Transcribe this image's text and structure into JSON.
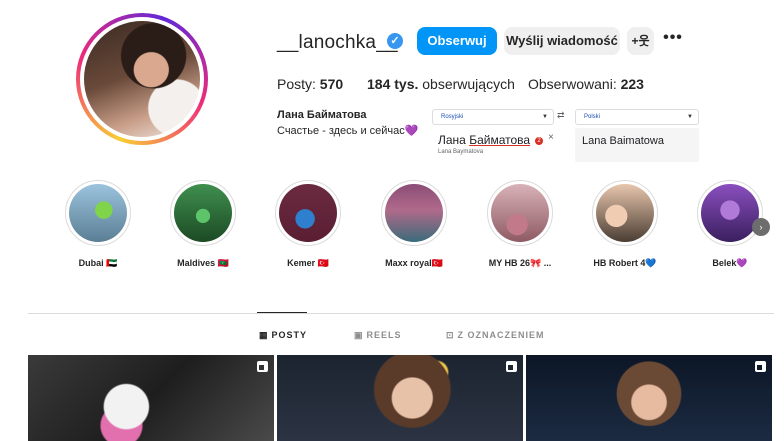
{
  "profile": {
    "username": "__lanochka__",
    "verified_icon": "verified-badge-icon",
    "follow_label": "Obserwuj",
    "message_label": "Wyślij wiadomość",
    "add_user_label": "+웃",
    "more_label": "•••",
    "posts_label": "Posty:",
    "posts_count": "570",
    "followers_count": "184 tys.",
    "followers_label": "obserwujących",
    "following_label": "Obserwowani:",
    "following_count": "223",
    "full_name": "Лана Байматова",
    "bio": "Счастье - здесь и сейчас💜"
  },
  "translator": {
    "source_lang": "Rosyjski",
    "target_lang": "Polski",
    "swap_icon": "⇄",
    "source_text_part1": "Лана ",
    "source_text_part2": "Байматова",
    "source_transliteration": "Lana Baymatova",
    "badge": "2",
    "close_label": "×",
    "output_text": "Lana Baimatowa"
  },
  "highlights": [
    {
      "label": "Dubai 🇦🇪",
      "color1": "#9cc3dd",
      "color2": "#5a7f95"
    },
    {
      "label": "Maldives 🇲🇻",
      "color1": "#3f8f4e",
      "color2": "#1c4a24"
    },
    {
      "label": "Kemer 🇹🇷",
      "color1": "#2f7fcf",
      "color2": "#5a1e33"
    },
    {
      "label": "Maxx royal🇹🇷",
      "color1": "#8a4d77",
      "color2": "#3a6b7a"
    },
    {
      "label": "MY HB 26🎀 ...",
      "color1": "#d8b2b8",
      "color2": "#8e5a63"
    },
    {
      "label": "HB Robert 4💙",
      "color1": "#e8c6ad",
      "color2": "#4a3d33"
    },
    {
      "label": "Belek💜",
      "color1": "#8a4fbf",
      "color2": "#3a1f5e"
    }
  ],
  "tabs": {
    "posts": "POSTY",
    "reels": "REELS",
    "tagged": "Z OZNACZENIEM",
    "posts_icon": "▦",
    "reels_icon": "▣",
    "tagged_icon": "⊡"
  },
  "colors": {
    "accent": "#0095f6",
    "verified": "#3797f0"
  }
}
